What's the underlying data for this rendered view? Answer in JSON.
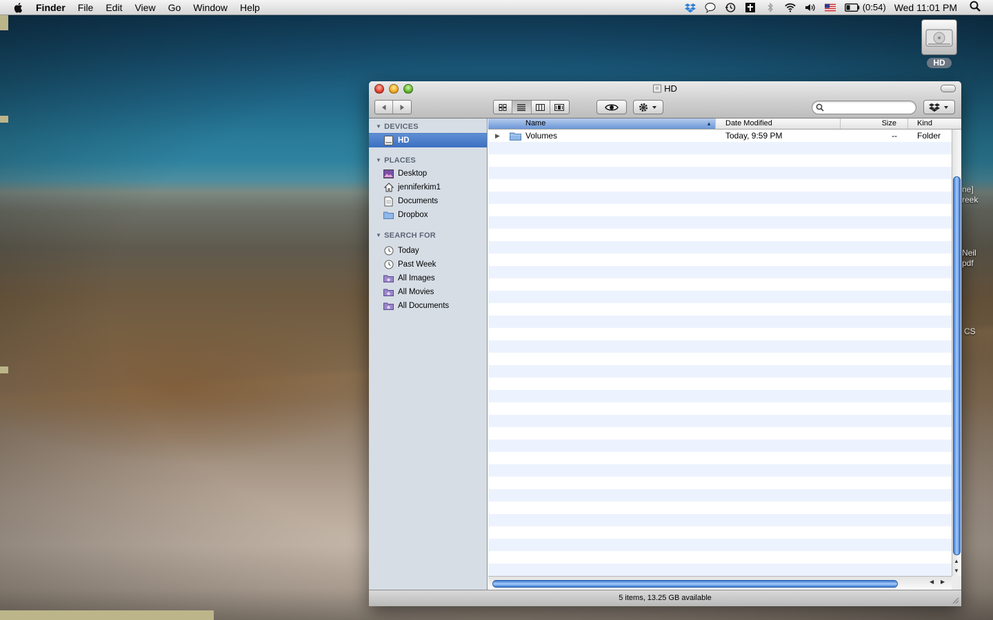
{
  "menubar": {
    "app_name": "Finder",
    "menus": [
      "File",
      "Edit",
      "View",
      "Go",
      "Window",
      "Help"
    ],
    "battery_time": "(0:54)",
    "clock": "Wed 11:01 PM",
    "status_icons": [
      "dropbox-icon",
      "chat-icon",
      "time-machine-icon",
      "script-icon",
      "bluetooth-icon",
      "wifi-icon",
      "volume-icon",
      "us-flag-icon",
      "battery-icon",
      "spotlight-icon"
    ]
  },
  "desktop": {
    "hd_label": "HD",
    "peek_labels": [
      "ne]",
      "reek",
      "Neil",
      "pdf",
      "CS"
    ]
  },
  "window": {
    "title": "HD",
    "search": {
      "placeholder": "",
      "value": ""
    },
    "sidebar": {
      "devices_header": "DEVICES",
      "devices": [
        {
          "label": "HD",
          "icon": "hard-disk-icon",
          "selected": true
        }
      ],
      "places_header": "PLACES",
      "places": [
        {
          "label": "Desktop",
          "icon": "desktop-icon"
        },
        {
          "label": "jenniferkim1",
          "icon": "home-icon"
        },
        {
          "label": "Documents",
          "icon": "documents-icon"
        },
        {
          "label": "Dropbox",
          "icon": "folder-icon"
        }
      ],
      "search_header": "SEARCH FOR",
      "searches": [
        {
          "label": "Today",
          "icon": "clock-icon"
        },
        {
          "label": "Past Week",
          "icon": "clock-icon"
        },
        {
          "label": "All Images",
          "icon": "smart-folder-icon"
        },
        {
          "label": "All Movies",
          "icon": "smart-folder-icon"
        },
        {
          "label": "All Documents",
          "icon": "smart-folder-icon"
        }
      ]
    },
    "columns": {
      "name": "Name",
      "date": "Date Modified",
      "size": "Size",
      "kind": "Kind"
    },
    "rows": [
      {
        "name": "Volumes",
        "date": "Today, 9:59 PM",
        "size": "--",
        "kind": "Folder"
      }
    ],
    "status": "5 items, 13.25 GB available",
    "accent_color": "#3b6fc1"
  }
}
